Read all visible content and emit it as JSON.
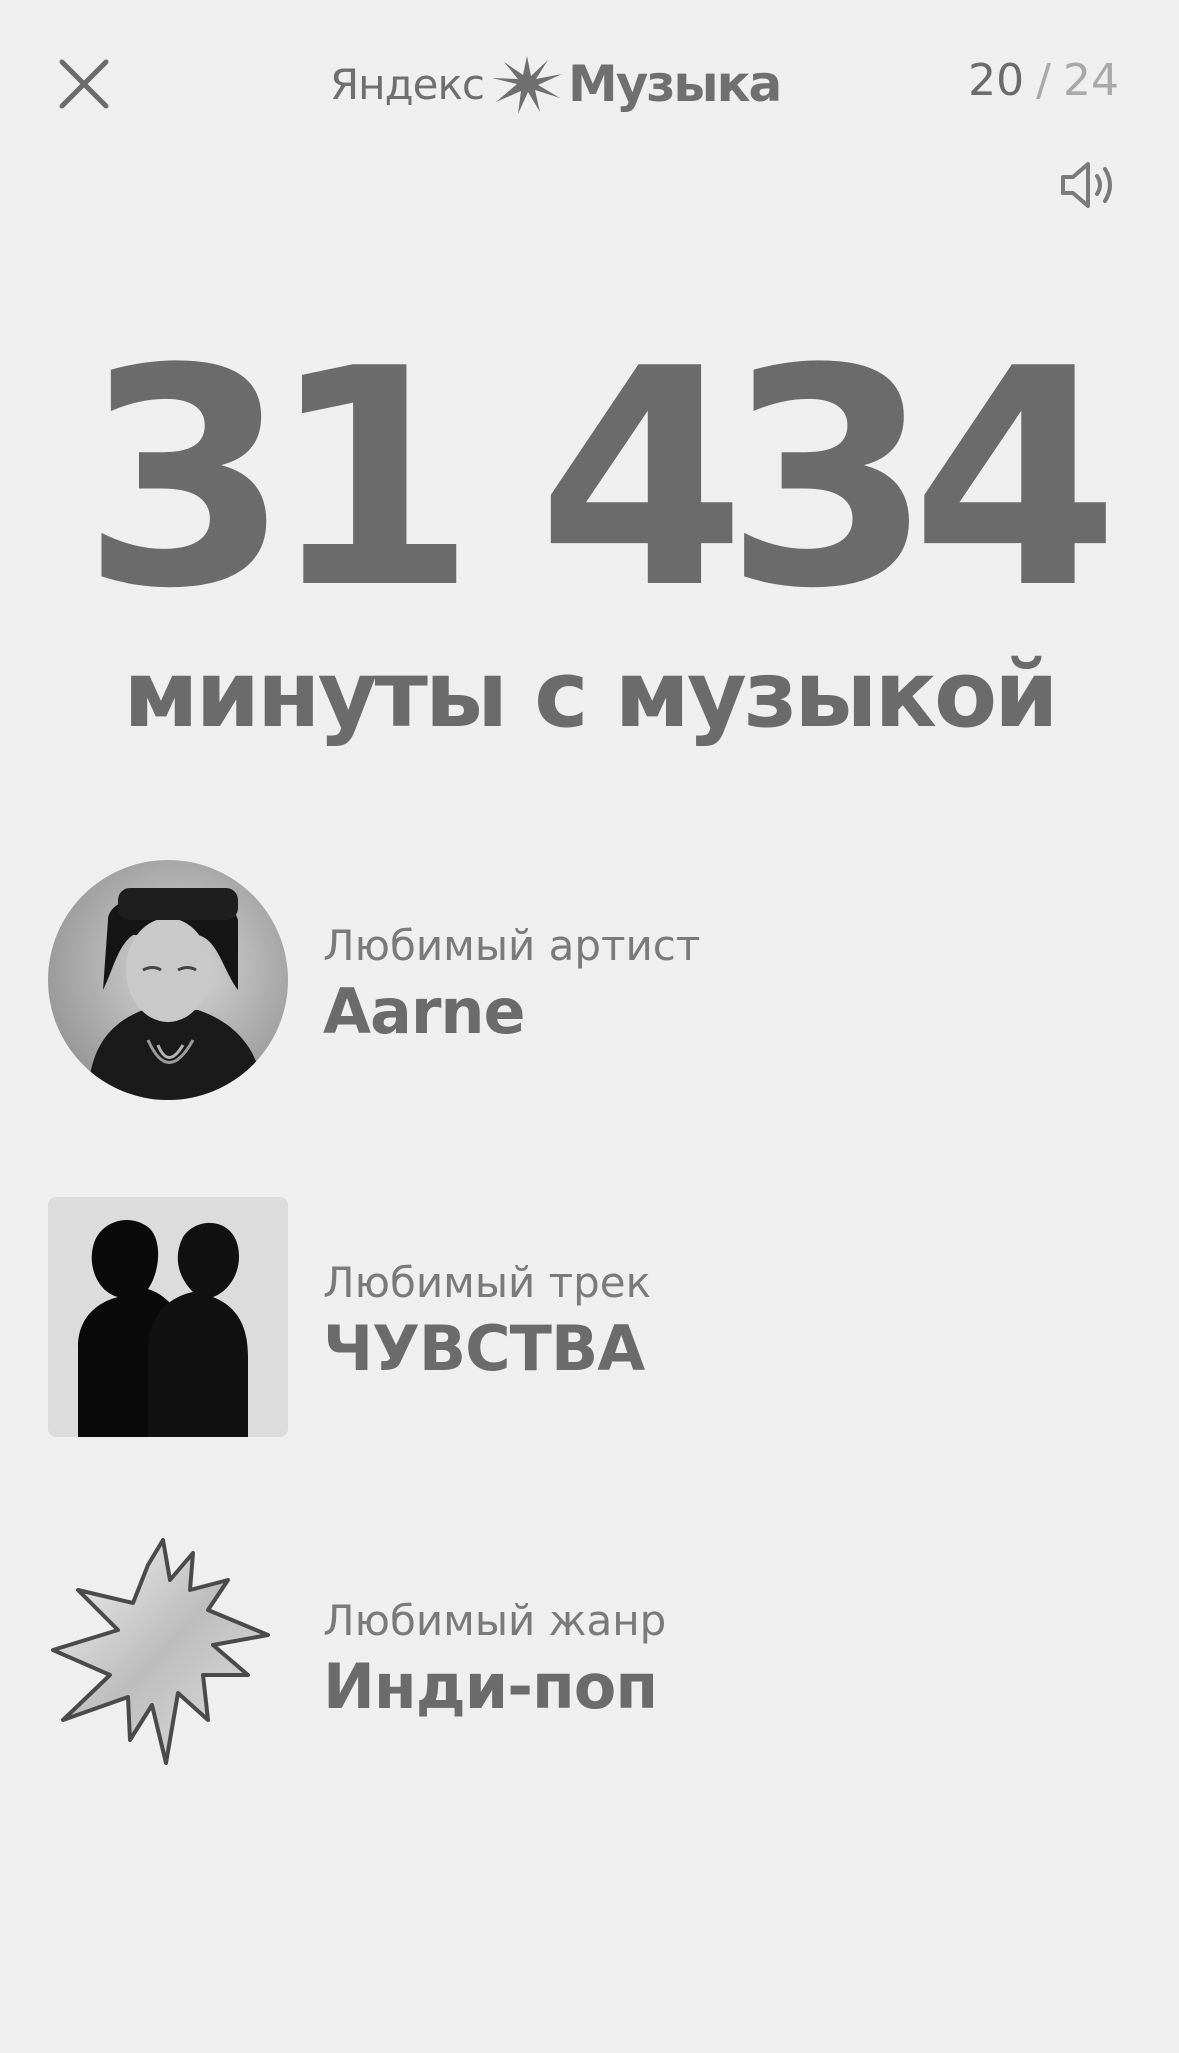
{
  "header": {
    "logo_word1": "Яндекс",
    "logo_word2": "Музыка",
    "counter_current": "20",
    "counter_separator": "/",
    "counter_total": "24"
  },
  "stats": {
    "minutes_value": "31 434",
    "minutes_label": "минуты с музыкой"
  },
  "favorites": [
    {
      "label": "Любимый артист",
      "value": "Aarne"
    },
    {
      "label": "Любимый трек",
      "value": "ЧУВСТВА"
    },
    {
      "label": "Любимый жанр",
      "value": "Инди-поп"
    }
  ],
  "icons": {
    "close": "close-icon",
    "sound": "speaker-icon",
    "genre": "starburst-icon"
  }
}
